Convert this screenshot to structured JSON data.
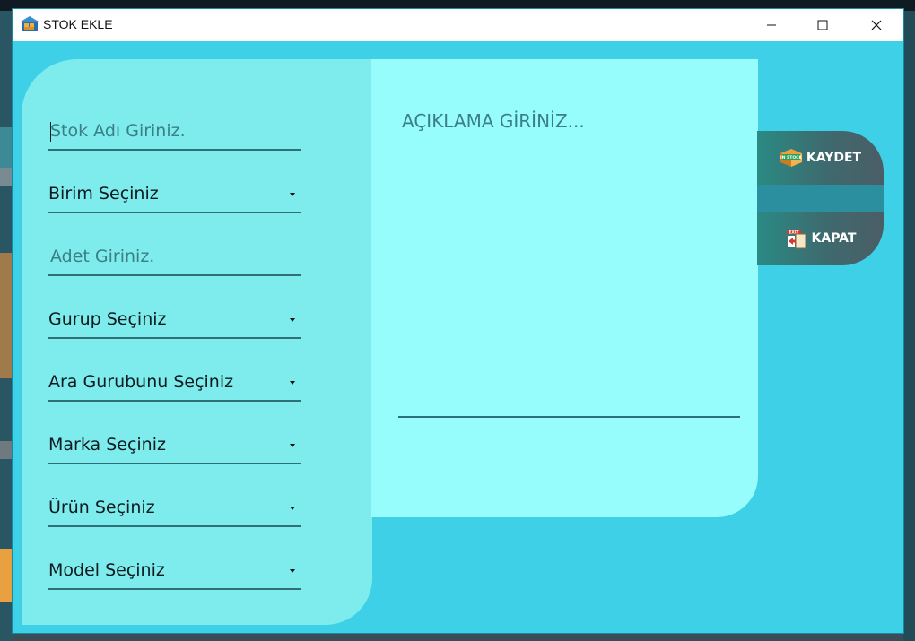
{
  "window": {
    "title": "STOK EKLE",
    "controls": {
      "minimize": "minimize",
      "maximize": "maximize",
      "close": "close"
    }
  },
  "form": {
    "stock_name_placeholder": "Stok Adı Giriniz.",
    "unit_select": "Birim Seçiniz",
    "quantity_placeholder": "Adet Giriniz.",
    "group_select": "Gurup Seçiniz",
    "subgroup_select": "Ara Gurubunu Seçiniz",
    "brand_select": "Marka Seçiniz",
    "product_select": "Ürün Seçiniz",
    "model_select": "Model Seçiniz"
  },
  "description": {
    "placeholder": "AÇIKLAMA GİRİNİZ..."
  },
  "actions": {
    "save_label": "KAYDET",
    "save_icon": "instock-box-icon",
    "close_label": "KAPAT",
    "close_icon": "exit-door-icon"
  },
  "colors": {
    "window_bg": "#3ed0e6",
    "left_panel": "#7eecec",
    "desc_panel": "#96fcfc",
    "underline": "#2f6f78"
  }
}
